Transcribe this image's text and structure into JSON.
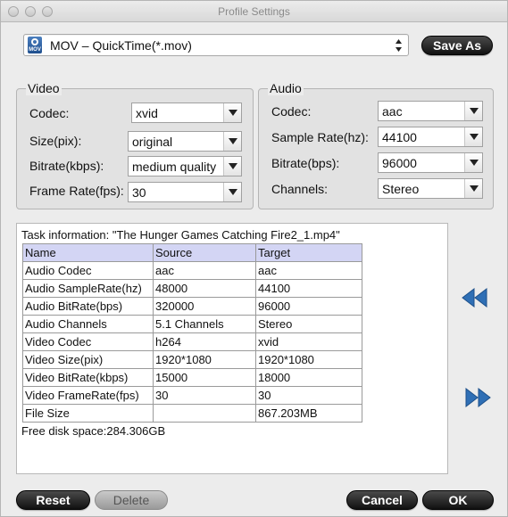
{
  "window": {
    "title": "Profile Settings"
  },
  "profile": {
    "icon": "mov-file-icon",
    "icon_label": "MOV",
    "label": "MOV – QuickTime(*.mov)"
  },
  "buttons": {
    "save_as": "Save As",
    "reset": "Reset",
    "delete": "Delete",
    "cancel": "Cancel",
    "ok": "OK"
  },
  "video": {
    "title": "Video",
    "codec_label": "Codec:",
    "codec": "xvid",
    "size_label": "Size(pix):",
    "size": "original",
    "bitrate_label": "Bitrate(kbps):",
    "bitrate": "medium quality",
    "framerate_label": "Frame Rate(fps):",
    "framerate": "30"
  },
  "audio": {
    "title": "Audio",
    "codec_label": "Codec:",
    "codec": "aac",
    "samplerate_label": "Sample Rate(hz):",
    "samplerate": "44100",
    "bitrate_label": "Bitrate(bps):",
    "bitrate": "96000",
    "channels_label": "Channels:",
    "channels": "Stereo"
  },
  "task": {
    "info": "Task information: \"The Hunger Games Catching Fire2_1.mp4\"",
    "headers": [
      "Name",
      "Source",
      "Target"
    ],
    "rows": [
      [
        "Audio Codec",
        "aac",
        "aac"
      ],
      [
        "Audio SampleRate(hz)",
        "48000",
        "44100"
      ],
      [
        "Audio BitRate(bps)",
        "320000",
        "96000"
      ],
      [
        "Audio Channels",
        "5.1 Channels",
        "Stereo"
      ],
      [
        "Video Codec",
        "h264",
        "xvid"
      ],
      [
        "Video Size(pix)",
        "1920*1080",
        "1920*1080"
      ],
      [
        "Video BitRate(kbps)",
        "15000",
        "18000"
      ],
      [
        "Video FrameRate(fps)",
        "30",
        "30"
      ],
      [
        "File Size",
        "",
        "867.203MB"
      ]
    ],
    "free_space": "Free disk space:284.306GB"
  },
  "colors": {
    "header_row": "#d3d5f4",
    "arrow_blue": "#2f6fb5"
  }
}
